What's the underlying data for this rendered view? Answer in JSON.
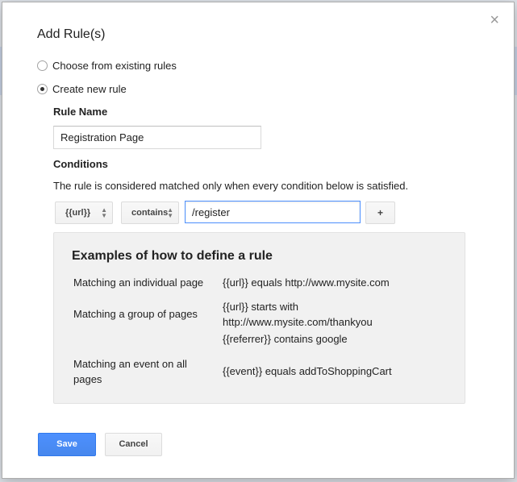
{
  "dialog": {
    "title": "Add Rule(s)",
    "close_glyph": "×"
  },
  "options": {
    "existing_label": "Choose from existing rules",
    "new_label": "Create new rule",
    "selected": "new"
  },
  "rule_name": {
    "label": "Rule Name",
    "value": "Registration Page"
  },
  "conditions": {
    "label": "Conditions",
    "description": "The rule is considered matched only when every condition below is satisfied.",
    "variable": "{{url}}",
    "operator": "contains",
    "value": "/register",
    "add_label": "+"
  },
  "examples": {
    "heading": "Examples of how to define a rule",
    "rows": [
      {
        "case": "Matching an individual page",
        "rules": [
          "{{url}} equals http://www.mysite.com"
        ]
      },
      {
        "case": "Matching a group of pages",
        "rules": [
          "{{url}} starts with http://www.mysite.com/thankyou",
          "{{referrer}} contains google"
        ]
      },
      {
        "case": "Matching an event on all pages",
        "rules": [
          "{{event}} equals addToShoppingCart"
        ]
      }
    ]
  },
  "actions": {
    "save_label": "Save",
    "cancel_label": "Cancel"
  },
  "colors": {
    "primary": "#4d90fe",
    "examples_bg": "#f1f1f1"
  }
}
